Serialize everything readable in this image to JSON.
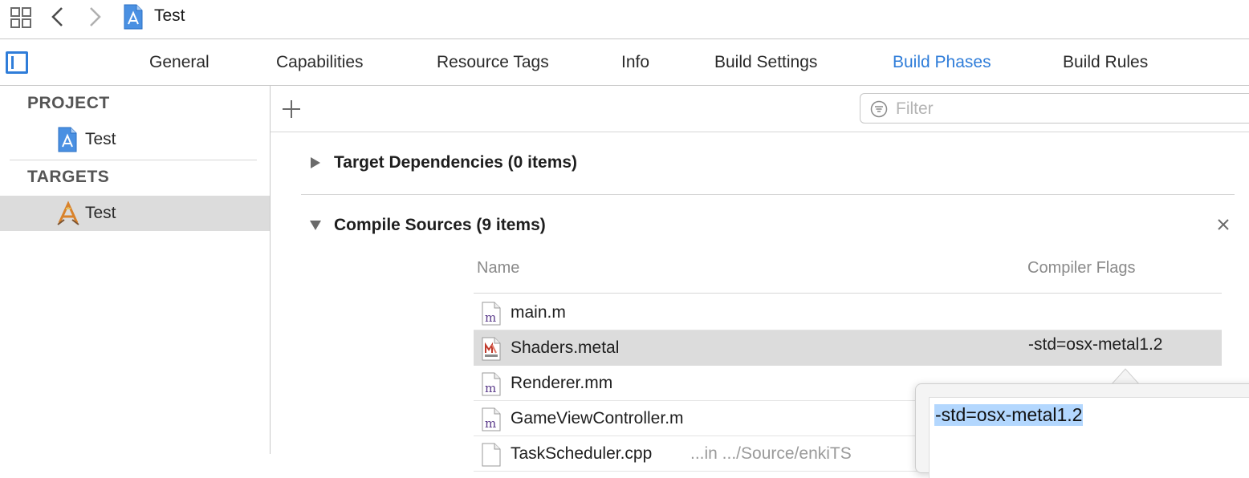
{
  "navbar": {
    "title": "Test",
    "icons": [
      "grid-icon",
      "back-chevron-icon",
      "forward-chevron-icon",
      "project-file-icon"
    ]
  },
  "tabs": {
    "items": [
      {
        "label": "General"
      },
      {
        "label": "Capabilities"
      },
      {
        "label": "Resource Tags"
      },
      {
        "label": "Info"
      },
      {
        "label": "Build Settings"
      },
      {
        "label": "Build Phases"
      },
      {
        "label": "Build Rules"
      }
    ],
    "active": "Build Phases"
  },
  "sidebar": {
    "project_header": "PROJECT",
    "project_item": "Test",
    "targets_header": "TARGETS",
    "target_item": "Test"
  },
  "toolbar": {
    "filter_placeholder": "Filter"
  },
  "phases": {
    "dependencies_title": "Target Dependencies (0 items)",
    "compile_title": "Compile Sources (9 items)"
  },
  "compile_table": {
    "col_name": "Name",
    "col_flags": "Compiler Flags",
    "rows": [
      {
        "name": "main.m",
        "flags": "",
        "path": ""
      },
      {
        "name": "Shaders.metal",
        "flags": "-std=osx-metal1.2",
        "path": ""
      },
      {
        "name": "Renderer.mm",
        "flags": "",
        "path": ""
      },
      {
        "name": "GameViewController.m",
        "flags": "",
        "path": ""
      },
      {
        "name": "TaskScheduler.cpp",
        "flags": "",
        "path": "...in .../Source/enkiTS"
      }
    ]
  },
  "flag_editor": {
    "value": "-std=osx-metal1.2"
  },
  "colors": {
    "accent": "#2f7dd9",
    "selection": "#dcdcdc",
    "text_highlight": "#b3d7fe"
  }
}
